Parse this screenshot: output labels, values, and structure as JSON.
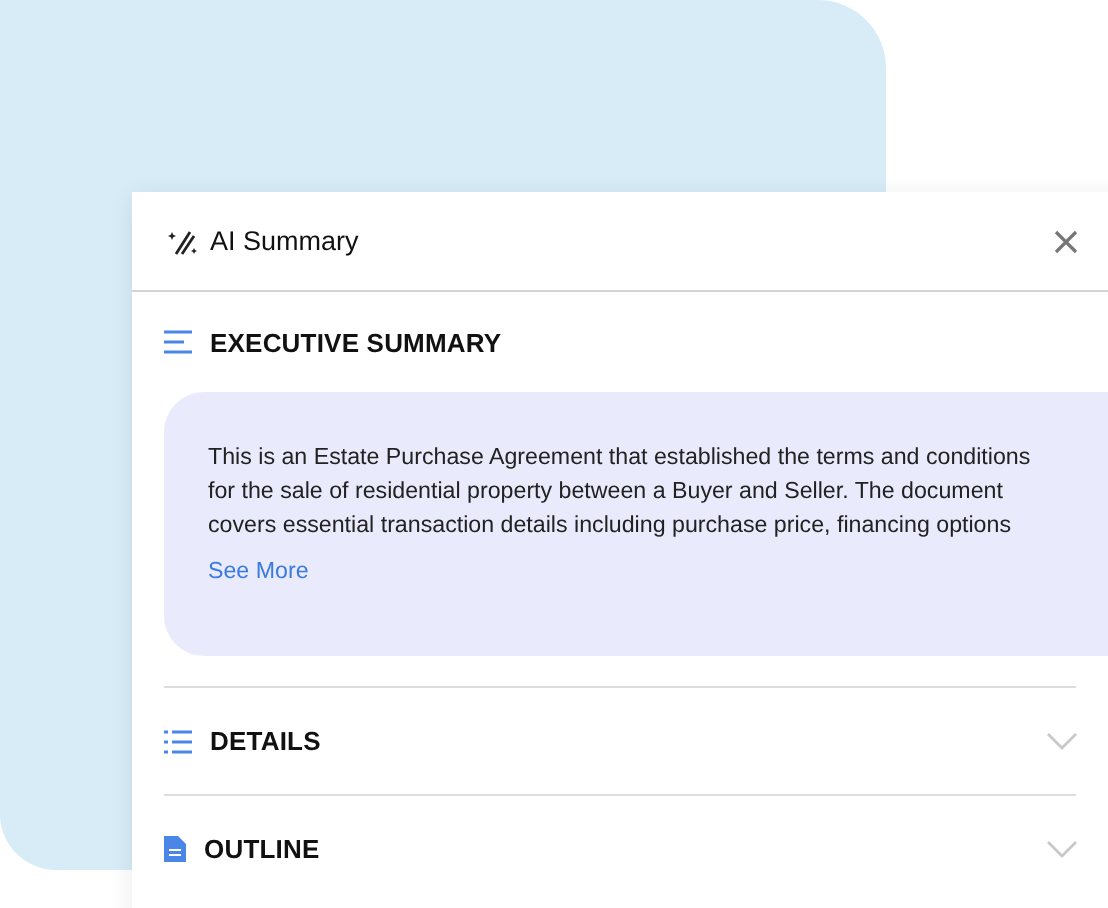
{
  "panel": {
    "title": "AI Summary"
  },
  "sections": [
    {
      "kind": "summary",
      "title": "EXECUTIVE SUMMARY",
      "expanded": true,
      "text": "This is an Estate Purchase Agreement that established the terms and conditions for the sale of residential property between a Buyer and Seller. The document covers essential transaction details including purchase price, financing options",
      "link": "See More"
    },
    {
      "kind": "list",
      "title": "DETAILS",
      "expanded": false
    },
    {
      "kind": "document",
      "title": "OUTLINE",
      "expanded": false
    }
  ]
}
